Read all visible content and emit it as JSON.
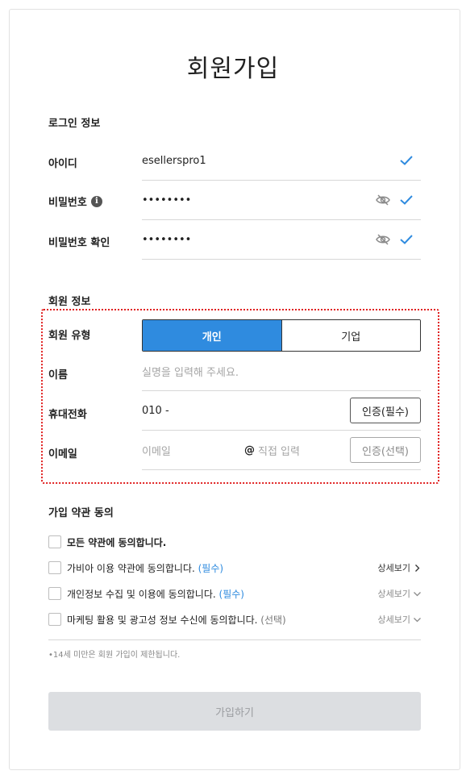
{
  "page_title": "회원가입",
  "login_section": {
    "title": "로그인 정보",
    "id_label": "아이디",
    "id_value": "esellerspro1",
    "password_label": "비밀번호",
    "password_value": "••••••••",
    "password_confirm_label": "비밀번호 확인",
    "password_confirm_value": "••••••••"
  },
  "member_section": {
    "title": "회원 정보",
    "type_label": "회원 유형",
    "type_options": [
      "개인",
      "기업"
    ],
    "type_selected": "개인",
    "name_label": "이름",
    "name_placeholder": "실명을 입력해 주세요.",
    "phone_label": "휴대전화",
    "phone_value": "010 -",
    "phone_verify_label": "인증(필수)",
    "email_label": "이메일",
    "email_placeholder": "이메일",
    "email_at": "@",
    "email_domain_placeholder": "직접 입력",
    "email_verify_label": "인증(선택)"
  },
  "terms_section": {
    "title": "가입 약관 동의",
    "agree_all": "모든 약관에 동의합니다.",
    "items": [
      {
        "text": "가비아 이용 약관에 동의합니다.",
        "tag": "(필수)",
        "detail": "상세보기",
        "expanded_icon": "chevron-right-icon"
      },
      {
        "text": "개인정보 수집 및 이용에 동의합니다.",
        "tag": "(필수)",
        "detail": "상세보기",
        "expanded_icon": "chevron-down-icon"
      },
      {
        "text": "마케팅 활용 및 광고성 정보 수신에 동의합니다.",
        "tag": "(선택)",
        "detail": "상세보기",
        "expanded_icon": "chevron-down-icon"
      }
    ],
    "notice": "•14세 미만은 회원 가입이 제한됩니다."
  },
  "submit_label": "가입하기",
  "colors": {
    "accent": "#2f8bdf",
    "check": "#2f8bdf",
    "highlight_border": "#e02020",
    "submit_disabled_bg": "#dcdee1"
  }
}
